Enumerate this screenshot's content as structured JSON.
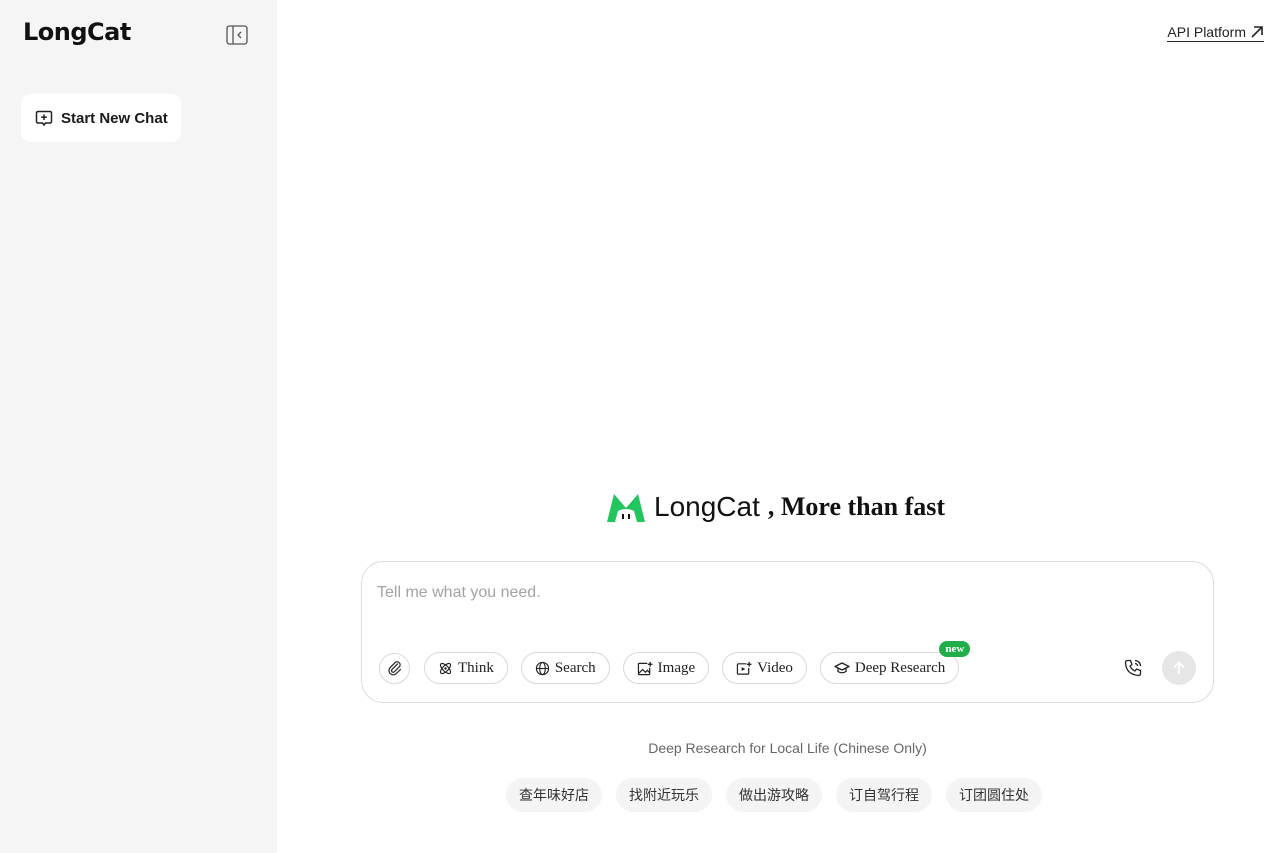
{
  "sidebar": {
    "logo": "LongCat",
    "new_chat_label": "Start New Chat"
  },
  "header": {
    "api_platform_label": "API Platform"
  },
  "hero": {
    "brand": "LongCat",
    "tagline": ", More than fast",
    "accent_color": "#22c55e"
  },
  "composer": {
    "placeholder": "Tell me what you need.",
    "tools": [
      {
        "label": "Think",
        "icon": "atom-icon"
      },
      {
        "label": "Search",
        "icon": "globe-icon"
      },
      {
        "label": "Image",
        "icon": "image-plus-icon"
      },
      {
        "label": "Video",
        "icon": "video-plus-icon"
      },
      {
        "label": "Deep Research",
        "icon": "graduation-cap-icon",
        "badge": "new"
      }
    ]
  },
  "suggestions": {
    "title": "Deep Research for Local Life (Chinese Only)",
    "chips": [
      "查年味好店",
      "找附近玩乐",
      "做出游攻略",
      "订自驾行程",
      "订团圆住处"
    ]
  }
}
